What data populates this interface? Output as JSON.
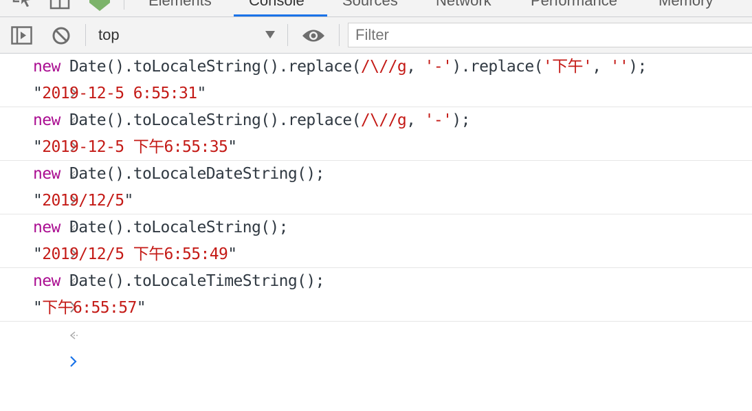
{
  "devtools": {
    "tabs": [
      {
        "label": "Elements",
        "active": false
      },
      {
        "label": "Console",
        "active": true
      },
      {
        "label": "Sources",
        "active": false
      },
      {
        "label": "Network",
        "active": false
      },
      {
        "label": "Performance",
        "active": false
      },
      {
        "label": "Memory",
        "active": false
      }
    ],
    "accent_color": "#1a73e8"
  },
  "toolbar": {
    "context": "top",
    "filter_placeholder": "Filter"
  },
  "console": {
    "entries": [
      {
        "input": {
          "kw": "new",
          "a": " Date().toLocaleString().replace(",
          "b": "/\\//g",
          "c": ", ",
          "d": "'-'",
          "e": ").replace(",
          "f": "'下午'",
          "g": ", ",
          "h": "''",
          "i": ");"
        },
        "output": "2019-12-5 6:55:31"
      },
      {
        "input": {
          "kw": "new",
          "a": " Date().toLocaleString().replace(",
          "b": "/\\//g",
          "c": ", ",
          "d": "'-'",
          "e": ");"
        },
        "output": "2019-12-5 下午6:55:35"
      },
      {
        "input": {
          "kw": "new",
          "a": " Date().toLocaleDateString();"
        },
        "output": "2019/12/5"
      },
      {
        "input": {
          "kw": "new",
          "a": " Date().toLocaleString();"
        },
        "output": "2019/12/5 下午6:55:49"
      },
      {
        "input": {
          "kw": "new",
          "a": " Date().toLocaleTimeString();"
        },
        "output": "下午6:55:57"
      }
    ],
    "colors": {
      "keyword": "#aa0d91",
      "string": "#c41a16",
      "prompt": "#1a73e8"
    }
  }
}
